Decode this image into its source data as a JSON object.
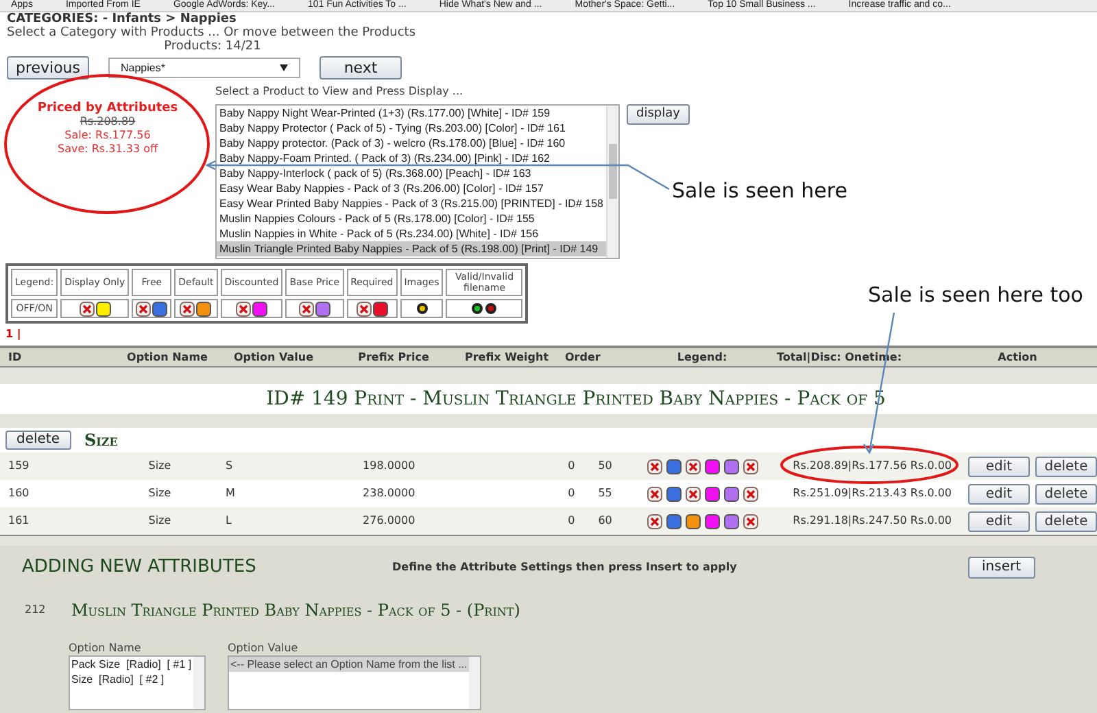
{
  "bookmarks": [
    "Apps",
    "Imported From IE",
    "Google AdWords: Key...",
    "101 Fun Activities To ...",
    "Hide What's New and ...",
    "Mother's Space: Getti...",
    "Top 10 Small Business ...",
    "Increase traffic and co..."
  ],
  "breadcrumb": "CATEGORIES: - Infants > Nappies",
  "instruction": "Select a Category with Products ... Or move between the Products",
  "product_count": "Products: 14/21",
  "nav": {
    "previous": "previous",
    "category": "Nappies*",
    "next": "next"
  },
  "product_prompt": "Select a Product to View and Press Display ...",
  "products": [
    {
      "label": "Baby Nappy Night Wear-Printed (1+3) (Rs.177.00) [White] - ID# 159",
      "selected": false
    },
    {
      "label": "Baby Nappy Protector ( Pack of 5) - Tying (Rs.203.00) [Color] - ID# 161",
      "selected": false
    },
    {
      "label": "Baby Nappy protector. (Pack of 3) - welcro (Rs.178.00) [Blue] - ID# 160",
      "selected": false
    },
    {
      "label": "Baby Nappy-Foam Printed. ( Pack of 3) (Rs.234.00) [Pink] - ID# 162",
      "selected": false
    },
    {
      "label": "Baby Nappy-Interlock ( pack of 5) (Rs.368.00) [Peach] - ID# 163",
      "selected": false
    },
    {
      "label": "Easy Wear Baby Nappies - Pack of 3 (Rs.206.00) [Color] - ID# 157",
      "selected": false
    },
    {
      "label": "Easy Wear Printed Baby Nappies - Pack of 3 (Rs.215.00) [PRINTED] - ID# 158",
      "selected": false
    },
    {
      "label": "Muslin Nappies Colours - Pack of 5 (Rs.178.00) [Color] - ID# 155",
      "selected": false
    },
    {
      "label": "Muslin Nappies in White - Pack of 5 (Rs.234.00) [White] - ID# 156",
      "selected": false
    },
    {
      "label": "Muslin Triangle Printed Baby Nappies - Pack of 5 (Rs.198.00) [Print] - ID# 149",
      "selected": true
    }
  ],
  "display_button": "display",
  "price_box": {
    "title": "Priced by Attributes",
    "old_price": "Rs.208.89",
    "sale": "Sale: Rs.177.56",
    "save": "Save: Rs.31.33 off"
  },
  "annotations": [
    "Sale is seen here",
    "Sale is seen here too"
  ],
  "legend": {
    "label": "Legend:",
    "row_label": "OFF/ON",
    "items": [
      {
        "kind": "pair",
        "label": "Display Only",
        "color": "#ffee00"
      },
      {
        "kind": "pair",
        "label": "Free",
        "color": "#3b6fe0"
      },
      {
        "kind": "pair",
        "label": "Default",
        "color": "#f29010"
      },
      {
        "kind": "pair",
        "label": "Discounted",
        "color": "#f010f0"
      },
      {
        "kind": "pair",
        "label": "Base Price",
        "color": "#b070f0"
      },
      {
        "kind": "pair",
        "label": "Required",
        "color": "#e8102a"
      },
      {
        "kind": "dot",
        "label": "Images",
        "color": "#e8c000"
      },
      {
        "kind": "twin",
        "label": "Valid/Invalid filename",
        "color": "#20c020"
      }
    ]
  },
  "pages": "1 |",
  "columns": [
    "ID",
    "Option Name",
    "Option Value",
    "Prefix Price",
    "Prefix Weight",
    "Order",
    "Legend:",
    "Total|Disc: Onetime:",
    "Action"
  ],
  "product_title": "ID# 149 Print - Muslin Triangle Printed Baby Nappies - Pack of 5",
  "group": {
    "delete": "delete",
    "name": "Size"
  },
  "rows": [
    {
      "id": "159",
      "name": "Size",
      "value": "S",
      "price": "198.0000",
      "weight": "0",
      "order": "50",
      "flags": [
        false,
        true,
        false,
        true,
        true,
        false
      ],
      "total": "Rs.208.89|Rs.177.56 Rs.0.00",
      "edit": "edit",
      "delete": "delete"
    },
    {
      "id": "160",
      "name": "Size",
      "value": "M",
      "price": "238.0000",
      "weight": "0",
      "order": "55",
      "flags": [
        false,
        true,
        false,
        true,
        true,
        false
      ],
      "total": "Rs.251.09|Rs.213.43 Rs.0.00",
      "edit": "edit",
      "delete": "delete"
    },
    {
      "id": "161",
      "name": "Size",
      "value": "L",
      "price": "276.0000",
      "weight": "0",
      "order": "60",
      "flags": [
        false,
        true,
        true,
        true,
        true,
        false
      ],
      "total": "Rs.291.18|Rs.247.50 Rs.0.00",
      "edit": "edit",
      "delete": "delete"
    }
  ],
  "adding": {
    "title": "ADDING NEW ATTRIBUTES",
    "hint": "Define the Attribute Settings then press Insert to apply",
    "insert": "insert",
    "product_id": "212",
    "product_name": "Muslin Triangle Printed Baby Nappies - Pack of 5 - (Print)",
    "option_name": {
      "label": "Option Name",
      "items": [
        "Pack Size  [Radio]  [ #1 ]",
        "Size  [Radio]  [ #2 ]"
      ]
    },
    "option_value": {
      "label": "Option Value",
      "items": [
        "<-- Please select an Option Name from the list ..."
      ]
    }
  }
}
